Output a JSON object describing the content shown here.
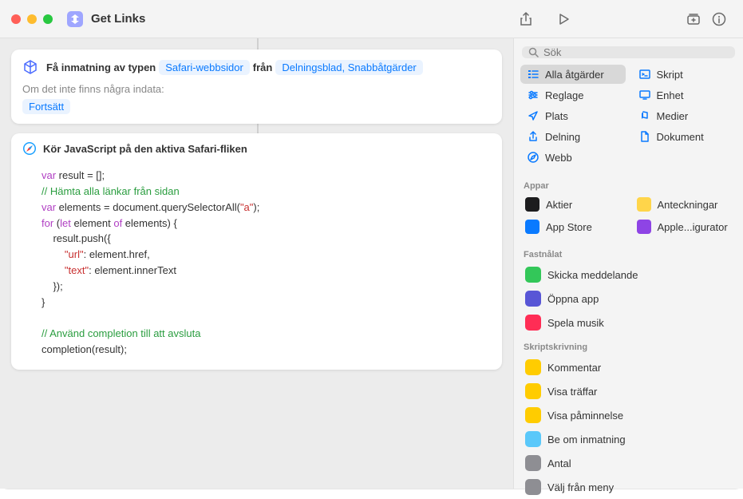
{
  "window": {
    "title": "Get Links"
  },
  "input_card": {
    "lead": "Få inmatning av typen",
    "token1": "Safari-webbsidor",
    "from": "från",
    "token2": "Delningsblad, Snabbåtgärder",
    "no_input_label": "Om det inte finns några indata:",
    "continue": "Fortsätt"
  },
  "js_card": {
    "title": "Kör JavaScript på den aktiva Safari-fliken",
    "code": {
      "l1_kw": "var",
      "l1_rest": " result = [];",
      "l2": "// Hämta alla länkar från sidan",
      "l3_kw": "var",
      "l3_rest": " elements = document.querySelectorAll(",
      "l3_str": "\"a\"",
      "l3_end": ");",
      "l4_kw": "for",
      "l4_rest": " (",
      "l4_kw2": "let",
      "l4_rest2": " element ",
      "l4_kw3": "of",
      "l4_rest3": " elements) {",
      "l5": "    result.push({",
      "l6_pre": "        ",
      "l6_str": "\"url\"",
      "l6_rest": ": element.href,",
      "l7_pre": "        ",
      "l7_str": "\"text\"",
      "l7_rest": ": element.innerText",
      "l8": "    });",
      "l9": "}",
      "l10": "",
      "l11": "// Använd completion till att avsluta",
      "l12": "completion(result);"
    }
  },
  "sidebar": {
    "search_placeholder": "Sök",
    "categories": [
      {
        "label": "Alla åtgärder",
        "selected": true,
        "icon": "list",
        "color": "#0a7aff"
      },
      {
        "label": "Skript",
        "icon": "terminal",
        "color": "#0a7aff"
      },
      {
        "label": "Reglage",
        "icon": "sliders",
        "color": "#0a7aff"
      },
      {
        "label": "Enhet",
        "icon": "display",
        "color": "#0a7aff"
      },
      {
        "label": "Plats",
        "icon": "location",
        "color": "#0a7aff"
      },
      {
        "label": "Medier",
        "icon": "note",
        "color": "#0a7aff"
      },
      {
        "label": "Delning",
        "icon": "share",
        "color": "#0a7aff"
      },
      {
        "label": "Dokument",
        "icon": "doc",
        "color": "#0a7aff"
      },
      {
        "label": "Webb",
        "icon": "safari",
        "color": "#0a7aff"
      }
    ],
    "apps_header": "Appar",
    "apps": [
      {
        "label": "Aktier",
        "bg": "#1c1c1e"
      },
      {
        "label": "Anteckningar",
        "bg": "#ffd54a"
      },
      {
        "label": "App Store",
        "bg": "#0a7aff"
      },
      {
        "label": "Apple...igurator",
        "bg": "#8e44e5"
      }
    ],
    "pinned_header": "Fastnålat",
    "pinned": [
      {
        "label": "Skicka meddelande",
        "bg": "#33c759"
      },
      {
        "label": "Öppna app",
        "bg": "#5856d6"
      },
      {
        "label": "Spela musik",
        "bg": "#ff2d55"
      }
    ],
    "scripting_header": "Skriptskrivning",
    "scripting": [
      {
        "label": "Kommentar",
        "bg": "#ffcc00"
      },
      {
        "label": "Visa träffar",
        "bg": "#ffcc00"
      },
      {
        "label": "Visa påminnelse",
        "bg": "#ffcc00"
      },
      {
        "label": "Be om inmatning",
        "bg": "#5ac8fa"
      },
      {
        "label": "Antal",
        "bg": "#8e8e93"
      },
      {
        "label": "Välj från meny",
        "bg": "#8e8e93"
      }
    ]
  }
}
